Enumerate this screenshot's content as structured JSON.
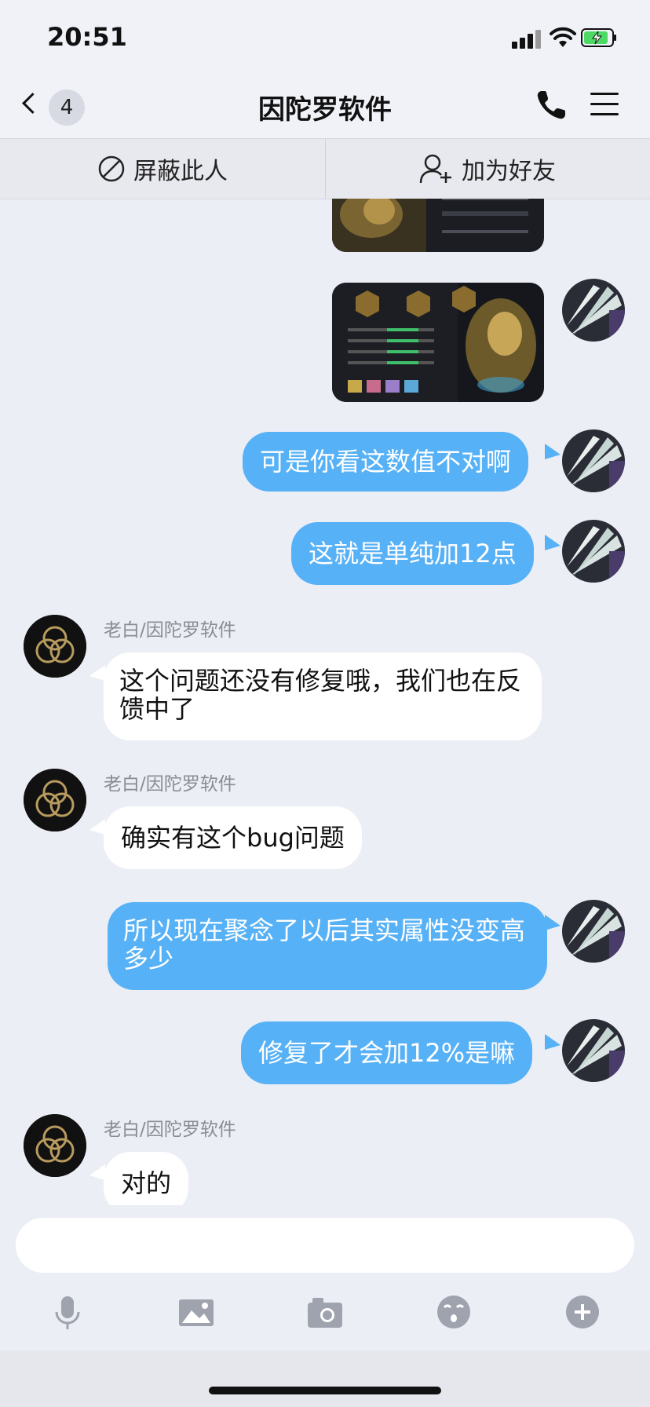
{
  "status": {
    "time": "20:51"
  },
  "nav": {
    "back_count": "4",
    "title": "因陀罗软件"
  },
  "actions": {
    "block_label": "屏蔽此人",
    "add_friend_label": "加为好友"
  },
  "messages": [
    {
      "type": "image",
      "from": "me",
      "caption": ""
    },
    {
      "type": "image",
      "from": "me",
      "caption": ""
    },
    {
      "type": "text",
      "from": "me",
      "text": "可是你看这数值不对啊"
    },
    {
      "type": "text",
      "from": "me",
      "text": "这就是单纯加12点"
    },
    {
      "type": "text",
      "from": "other",
      "sender": "老白/因陀罗软件",
      "text": "这个问题还没有修复哦，我们也在反馈中了"
    },
    {
      "type": "text",
      "from": "other",
      "sender": "老白/因陀罗软件",
      "text": "确实有这个bug问题"
    },
    {
      "type": "text",
      "from": "me",
      "text": "所以现在聚念了以后其实属性没变高多少"
    },
    {
      "type": "text",
      "from": "me",
      "text": "修复了才会加12%是嘛"
    },
    {
      "type": "text",
      "from": "other",
      "sender": "老白/因陀罗软件",
      "text": "对的"
    }
  ],
  "input": {
    "placeholder": ""
  },
  "toolbar": [
    "microphone-icon",
    "image-icon",
    "camera-icon",
    "emoji-icon",
    "plus-icon"
  ],
  "colors": {
    "outgoing_bubble": "#57b1f6",
    "incoming_bubble": "#ffffff",
    "background": "#eceef6"
  }
}
